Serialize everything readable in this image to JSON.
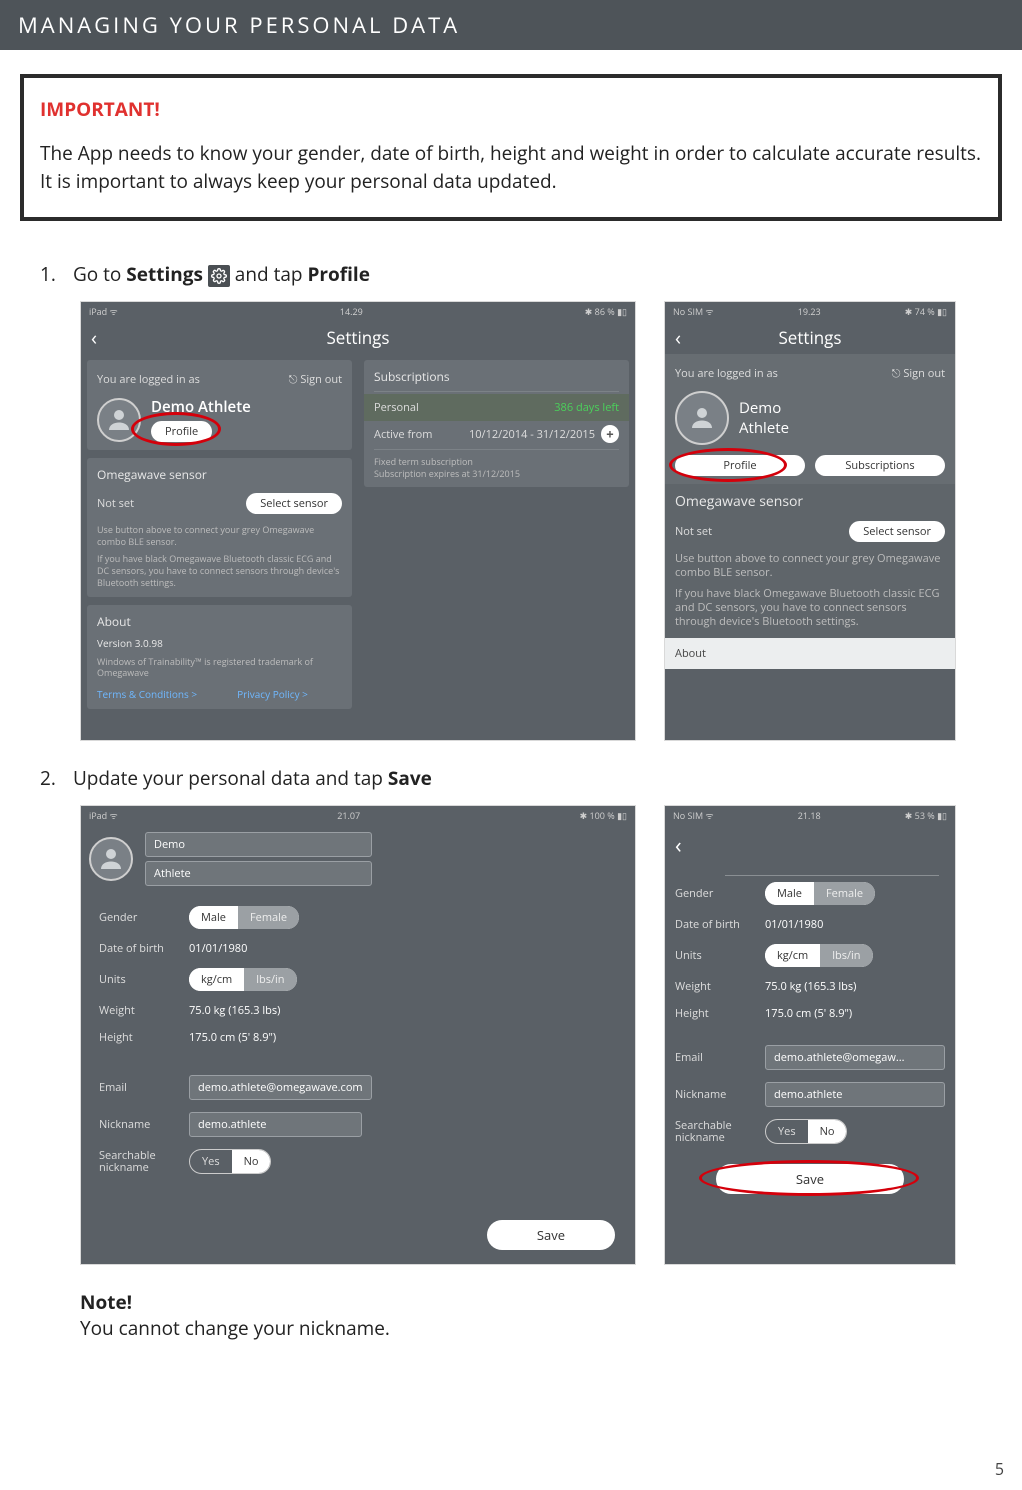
{
  "banner": "MANAGING YOUR PERSONAL DATA",
  "important": {
    "title": "IMPORTANT!",
    "text": "The App needs to know your gender, date of birth, height and weight in order to calculate accurate results. It is important to always keep your personal data updated."
  },
  "step1": {
    "num": "1.",
    "pre": "Go to ",
    "settings": "Settings",
    "mid": " and tap ",
    "profile": "Profile"
  },
  "step2": {
    "num": "2.",
    "pre": "Update your personal data and tap ",
    "save": "Save"
  },
  "note": {
    "title": "Note!",
    "text": "You cannot change your nickname."
  },
  "pageNum": "5",
  "ipad1": {
    "carrier": "iPad",
    "time": "14.29",
    "battery": "86 %",
    "title": "Settings",
    "loggedInLabel": "You are logged in as",
    "signOut": "Sign out",
    "userName": "Demo Athlete",
    "profileBtn": "Profile",
    "sensorTitle": "Omegawave sensor",
    "sensorStatus": "Not set",
    "selectSensor": "Select sensor",
    "sensorHint1": "Use button above to connect your grey Omegawave combo BLE sensor.",
    "sensorHint2": "If you have black Omegawave Bluetooth classic ECG and DC sensors, you have to connect sensors through device's Bluetooth settings.",
    "aboutTitle": "About",
    "version": "Version 3.0.98",
    "trademark": "Windows of Trainability™ is registered trademark of Omegawave",
    "terms": "Terms & Conditions >",
    "privacy": "Privacy Policy >",
    "subsTitle": "Subscriptions",
    "personal": "Personal",
    "daysLeft": "386 days left",
    "activeFrom": "Active from",
    "activeRange": "10/12/2014 - 31/12/2015",
    "fixed1": "Fixed term subscription",
    "fixed2": "Subscription expires at 31/12/2015"
  },
  "iphone1": {
    "carrier": "No SIM",
    "time": "19.23",
    "battery": "74 %",
    "title": "Settings",
    "loggedInLabel": "You are logged in as",
    "signOut": "Sign out",
    "userFirst": "Demo",
    "userLast": "Athlete",
    "profileBtn": "Profile",
    "subsBtn": "Subscriptions",
    "sensorTitle": "Omegawave sensor",
    "sensorStatus": "Not set",
    "selectSensor": "Select sensor",
    "sensorHint1": "Use button above to connect your grey Omegawave combo BLE sensor.",
    "sensorHint2": "If you have black Omegawave Bluetooth classic ECG and DC sensors, you have to connect sensors through device's Bluetooth settings.",
    "aboutTitle": "About"
  },
  "ipad2": {
    "carrier": "iPad",
    "time": "21.07",
    "battery": "100 %",
    "first": "Demo",
    "last": "Athlete",
    "genderLbl": "Gender",
    "male": "Male",
    "female": "Female",
    "dobLbl": "Date of birth",
    "dob": "01/01/1980",
    "unitsLbl": "Units",
    "metric": "kg/cm",
    "imperial": "lbs/in",
    "weightLbl": "Weight",
    "weight": "75.0 kg (165.3 lbs)",
    "heightLbl": "Height",
    "height": "175.0 cm (5' 8.9\")",
    "emailLbl": "Email",
    "email": "demo.athlete@omegawave.com",
    "nickLbl": "Nickname",
    "nick": "demo.athlete",
    "searchLbl": "Searchable nickname",
    "yes": "Yes",
    "no": "No",
    "save": "Save"
  },
  "iphone2": {
    "carrier": "No SIM",
    "time": "21.18",
    "battery": "53 %",
    "genderLbl": "Gender",
    "male": "Male",
    "female": "Female",
    "dobLbl": "Date of birth",
    "dob": "01/01/1980",
    "unitsLbl": "Units",
    "metric": "kg/cm",
    "imperial": "lbs/in",
    "weightLbl": "Weight",
    "weight": "75.0 kg (165.3 lbs)",
    "heightLbl": "Height",
    "height": "175.0 cm (5' 8.9\")",
    "emailLbl": "Email",
    "email": "demo.athlete@omegaw...",
    "nickLbl": "Nickname",
    "nick": "demo.athlete",
    "searchLbl": "Searchable nickname",
    "yes": "Yes",
    "no": "No",
    "save": "Save"
  }
}
